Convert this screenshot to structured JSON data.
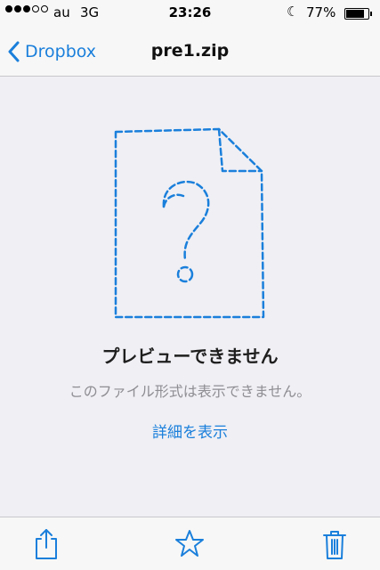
{
  "status_bar": {
    "carrier": "au",
    "network": "3G",
    "time": "23:26",
    "battery_text": "77%",
    "battery_level": 0.77,
    "signal_bars_filled": 3,
    "signal_bars_total": 5,
    "icons": [
      "moon-icon",
      "battery-icon"
    ]
  },
  "nav": {
    "back_label": "Dropbox",
    "title": "pre1.zip"
  },
  "preview": {
    "icon": "unknown-file-icon",
    "headline": "プレビューできません",
    "message": "このファイル形式は表示できません。",
    "details_link": "詳細を表示"
  },
  "toolbar": {
    "items": [
      "share-icon",
      "star-icon",
      "trash-icon"
    ]
  },
  "colors": {
    "accent": "#1a7fdb",
    "background": "#efeff4",
    "bar": "#f7f7f7",
    "secondary_text": "#8e8e93"
  }
}
